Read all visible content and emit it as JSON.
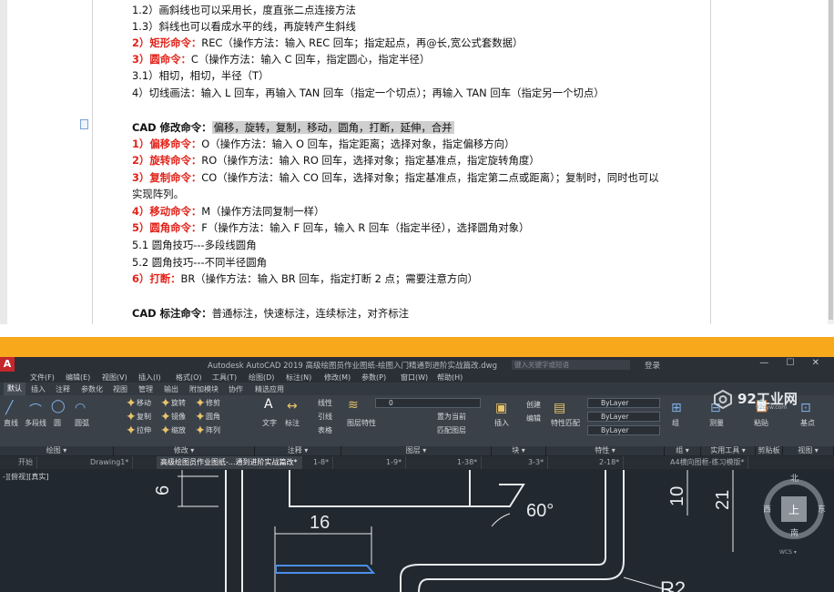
{
  "document": {
    "lines": [
      {
        "parts": [
          {
            "t": "1.2）画斜线也可以采用长，度直张二点连接方法"
          }
        ]
      },
      {
        "parts": [
          {
            "t": "1.3）斜线也可以看成水平的线，再旋转产生斜线"
          }
        ]
      },
      {
        "parts": [
          {
            "t": "2）矩形命令：",
            "s": "red"
          },
          {
            "t": "REC（操作方法：输入 REC 回车；指定起点，再@长,宽公式套数据）"
          }
        ]
      },
      {
        "parts": [
          {
            "t": "3）圆命令：",
            "s": "red"
          },
          {
            "t": "C（操作方法：输入 C 回车，指定圆心，指定半径）"
          }
        ]
      },
      {
        "parts": [
          {
            "t": "3.1）相切，相切，半径（T）"
          }
        ]
      },
      {
        "parts": [
          {
            "t": "4）切线画法：输入 L 回车，再输入 TAN 回车（指定一个切点）；再输入 TAN 回车（指定另一个切点）"
          }
        ]
      },
      {
        "parts": [
          {
            "t": ""
          }
        ]
      },
      {
        "parts": [
          {
            "t": "CAD 修改命令：",
            "s": "b"
          },
          {
            "t": "偏移，旋转，复制，移动，圆角，打断，延伸，合并",
            "s": "hl"
          }
        ]
      },
      {
        "parts": [
          {
            "t": "1）偏移命令：",
            "s": "red"
          },
          {
            "t": "O（操作方法：输入 O 回车，指定距离；选择对象，指定偏移方向）"
          }
        ]
      },
      {
        "parts": [
          {
            "t": "2）旋转命令：",
            "s": "red"
          },
          {
            "t": "RO（操作方法：输入 RO 回车，选择对象；指定基准点，指定旋转角度）"
          }
        ]
      },
      {
        "parts": [
          {
            "t": "3）复制命令：",
            "s": "red"
          },
          {
            "t": "CO（操作方法：输入 CO 回车，选择对象；指定基准点，指定第二点或距离）；复制时，同时也可以"
          }
        ]
      },
      {
        "parts": [
          {
            "t": "实现阵列。"
          }
        ]
      },
      {
        "parts": [
          {
            "t": "4）移动命令：",
            "s": "red"
          },
          {
            "t": "M（操作方法同复制一样）"
          }
        ]
      },
      {
        "parts": [
          {
            "t": "5）圆角命令：",
            "s": "red"
          },
          {
            "t": "F（操作方法：输入 F 回车，输入 R 回车（指定半径），选择圆角对象）"
          }
        ]
      },
      {
        "parts": [
          {
            "t": "5.1  圆角技巧---多段线圆角"
          }
        ]
      },
      {
        "parts": [
          {
            "t": "5.2  圆角技巧---不同半径圆角"
          }
        ]
      },
      {
        "parts": [
          {
            "t": "6）打断：",
            "s": "red"
          },
          {
            "t": "BR（操作方法：输入 BR 回车，指定打断 2 点；需要注意方向）"
          }
        ]
      },
      {
        "parts": [
          {
            "t": ""
          }
        ]
      },
      {
        "parts": [
          {
            "t": "CAD 标注命令：",
            "s": "b"
          },
          {
            "t": "普通标注，快速标注，连续标注，对齐标注"
          }
        ]
      }
    ]
  },
  "autocad": {
    "title": "Autodesk AutoCAD 2019   高级绘图员作业图纸-绘图入门精通到进阶实战篇改.dwg",
    "search_placeholder": "键入关键字或短语",
    "user": "登录",
    "logo_letter": "A",
    "menu": [
      "文件(F)",
      "编辑(E)",
      "视图(V)",
      "插入(I)",
      "格式(O)",
      "工具(T)",
      "绘图(D)",
      "标注(N)",
      "修改(M)",
      "参数(P)",
      "窗口(W)",
      "帮助(H)"
    ],
    "ribbon_tabs": [
      "默认",
      "插入",
      "注释",
      "参数化",
      "视图",
      "管理",
      "输出",
      "附加模块",
      "协作",
      "精选应用"
    ],
    "draw_tools": [
      "直线",
      "多段线",
      "圆",
      "圆弧"
    ],
    "modify_tools": [
      "移动",
      "旋转",
      "修剪",
      "复制",
      "镜像",
      "圆角",
      "拉伸",
      "缩放",
      "阵列"
    ],
    "annot_tools": [
      "文字",
      "标注",
      "线性",
      "引线",
      "表格"
    ],
    "layer_tools": [
      "图层特性",
      "置为当前",
      "匹配图层"
    ],
    "layer_value": "0",
    "block_tools": [
      "插入",
      "创建",
      "编辑"
    ],
    "prop_tools": [
      "特性匹配"
    ],
    "bylayer": [
      "ByLayer",
      "ByLayer",
      "ByLayer"
    ],
    "group_tools": [
      "组"
    ],
    "util_tools": [
      "测量"
    ],
    "clip_tools": [
      "粘贴"
    ],
    "base_tools": [
      "基点"
    ],
    "panels": [
      "绘图 ▾",
      "修改 ▾",
      "注释 ▾",
      "图层 ▾",
      "块 ▾",
      "特性 ▾",
      "组 ▾",
      "实用工具 ▾",
      "剪贴板",
      "视图 ▾"
    ],
    "doc_tabs": [
      "开始",
      "Drawing1*",
      "高级绘图员作业图纸-...通到进阶实战篇改*",
      "1-8*",
      "1-9*",
      "1-38*",
      "3-3*",
      "2-18*",
      "A4横向图框-练习模版*"
    ],
    "viewport_label": "-][俯视][真实]",
    "dims": [
      "6",
      "16",
      "60°",
      "10",
      "21",
      "R2"
    ],
    "viewcube": {
      "top": "上",
      "north": "北",
      "south": "南",
      "east": "东",
      "west": "西",
      "wcs": "WCS ▾"
    },
    "watermark": {
      "title": "92工业网",
      "url": "92gyw.com"
    }
  }
}
